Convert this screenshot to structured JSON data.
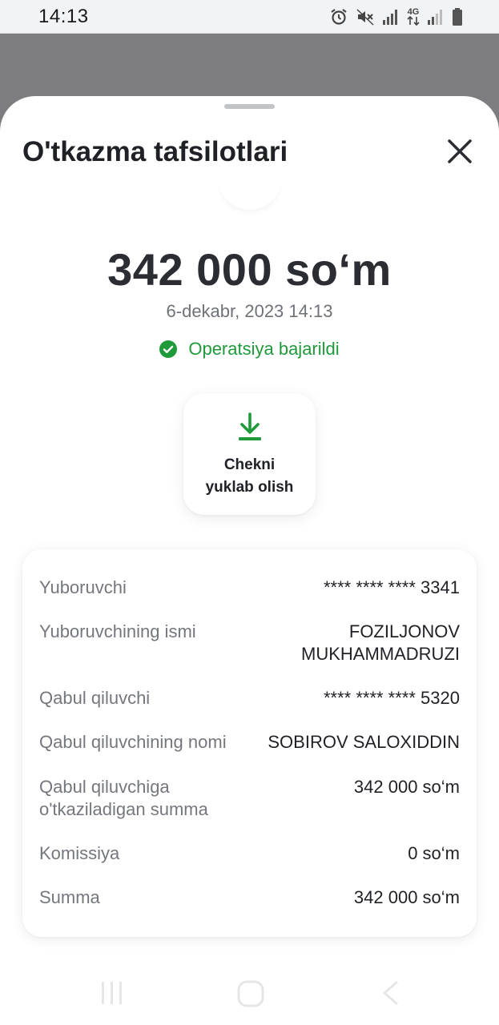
{
  "status_bar": {
    "time": "14:13",
    "network_label": "4G",
    "icons": [
      "alarm-icon",
      "mute-icon",
      "signal-icon",
      "network-4g-icon",
      "signal-weak-icon",
      "battery-icon"
    ]
  },
  "sheet": {
    "title": "O'tkazma tafsilotlari",
    "close_icon": "close-icon"
  },
  "transfer": {
    "amount": "342 000 so‘m",
    "date": "6-dekabr, 2023 14:13",
    "status_text": "Operatsiya bajarildi",
    "status_icon": "check-circle-icon",
    "status_color": "#1f9a3a"
  },
  "receipt_button": {
    "label": "Chekni\nyuklab olish",
    "icon": "download-icon",
    "icon_color": "#1f9a3a"
  },
  "details": [
    {
      "label": "Yuboruvchi",
      "value": "**** **** **** 3341"
    },
    {
      "label": "Yuboruvchining ismi",
      "value": "FOZILJONOV\nMUKHAMMADRUZI"
    },
    {
      "label": "Qabul qiluvchi",
      "value": "**** **** **** 5320"
    },
    {
      "label": "Qabul qiluvchining nomi",
      "value": "SOBIROV SALOXIDDIN"
    },
    {
      "label": "Qabul qiluvchiga\no'tkaziladigan summa",
      "value": "342 000 so‘m"
    },
    {
      "label": "Komissiya",
      "value": "0 so‘m"
    },
    {
      "label": "Summa",
      "value": "342 000 so‘m"
    }
  ],
  "nav_bar": {
    "buttons": [
      "recent-apps-icon",
      "home-icon",
      "back-icon"
    ]
  }
}
